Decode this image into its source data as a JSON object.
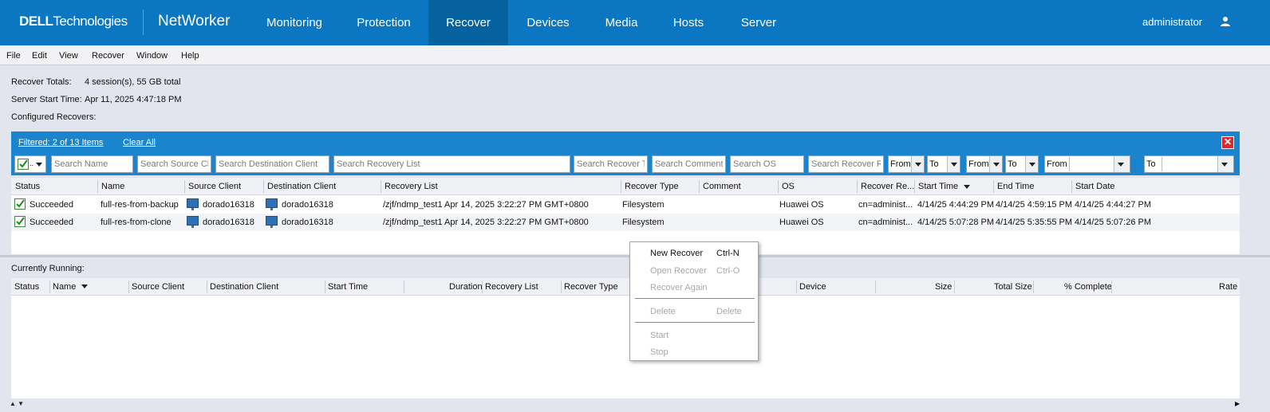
{
  "topnav": {
    "brand_dell": "DELL",
    "brand_tech": "Technologies",
    "product": "NetWorker",
    "tabs": [
      {
        "label": "Monitoring"
      },
      {
        "label": "Protection"
      },
      {
        "label": "Recover"
      },
      {
        "label": "Devices"
      },
      {
        "label": "Media"
      },
      {
        "label": "Hosts"
      },
      {
        "label": "Server"
      }
    ],
    "active_tab": "Recover",
    "user": "administrator",
    "user_icon": "person-icon",
    "colors": {
      "bar": "#0b76c1",
      "active": "#06619f"
    }
  },
  "menubar": {
    "items": [
      "File",
      "Edit",
      "View",
      "Recover",
      "Window",
      "Help"
    ]
  },
  "info": {
    "totals_label": "Recover Totals:",
    "totals_value": "4 session(s), 55 GB total",
    "start_label": "Server Start Time:",
    "start_value": "Apr 11, 2025 4:47:18 PM",
    "configured_label": "Configured Recovers:"
  },
  "filter": {
    "filtered_text": "Filtered: 2 of 13 Items",
    "clear_all": "Clear All",
    "close_icon": "close-icon",
    "placeholders": {
      "name": "Search Name",
      "source": "Search Source Client",
      "destination": "Search Destination Client",
      "recovery_list": "Search Recovery List",
      "recover_type": "Search Recover Type",
      "comment": "Search Comment",
      "os": "Search OS",
      "recover_r": "Search Recover Requestor"
    },
    "from_label": "From",
    "to_label": "To",
    "color": "#1a84cf"
  },
  "configured_table": {
    "columns": [
      "Status",
      "Name",
      "Source Client",
      "Destination Client",
      "Recovery List",
      "Recover Type",
      "Comment",
      "OS",
      "Recover Re...",
      "Start Time",
      "End Time",
      "Start Date"
    ],
    "rows": [
      {
        "status": "Succeeded",
        "name": "full-res-from-backup",
        "source": "dorado16318",
        "destination": "dorado16318",
        "recovery_list": "/zjf/ndmp_test1 Apr 14, 2025 3:22:27 PM GMT+0800",
        "recover_type": "Filesystem",
        "comment": "",
        "os": "Huawei OS",
        "recover_re": "cn=administ...",
        "start_time": "4/14/25 4:44:29 PM",
        "end_time": "4/14/25 4:59:15 PM",
        "start_date": "4/14/25 4:44:27 PM"
      },
      {
        "status": "Succeeded",
        "name": "full-res-from-clone",
        "source": "dorado16318",
        "destination": "dorado16318",
        "recovery_list": "/zjf/ndmp_test1 Apr 14, 2025 3:22:27 PM GMT+0800",
        "recover_type": "Filesystem",
        "comment": "",
        "os": "Huawei OS",
        "recover_re": "cn=administ...",
        "start_time": "4/14/25 5:07:28 PM",
        "end_time": "4/14/25 5:35:55 PM",
        "start_date": "4/14/25 5:07:26 PM"
      }
    ]
  },
  "running": {
    "label": "Currently Running:",
    "columns": [
      "Status",
      "Name",
      "Source Client",
      "Destination Client",
      "Start Time",
      "Duration",
      "Recovery List",
      "Recover Type",
      "Device",
      "Size",
      "Total Size",
      "% Complete",
      "Rate"
    ]
  },
  "context_menu": {
    "items": [
      {
        "label": "New Recover",
        "shortcut": "Ctrl-N",
        "enabled": true
      },
      {
        "label": "Open Recover",
        "shortcut": "Ctrl-O",
        "enabled": false
      },
      {
        "label": "Recover Again",
        "shortcut": "",
        "enabled": false
      },
      {
        "label": "Delete",
        "shortcut": "Delete",
        "enabled": false
      },
      {
        "label": "Start",
        "shortcut": "",
        "enabled": false
      },
      {
        "label": "Stop",
        "shortcut": "",
        "enabled": false
      }
    ]
  }
}
